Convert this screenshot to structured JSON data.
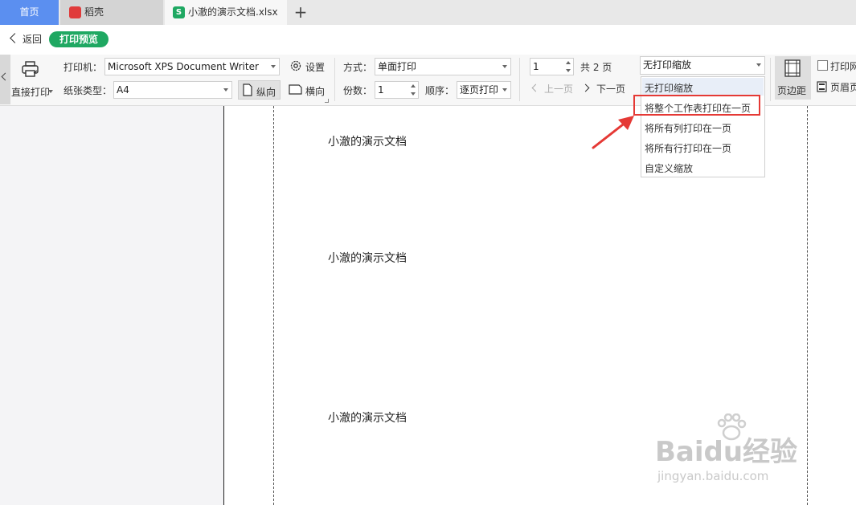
{
  "tabs": {
    "home": "首页",
    "daoke": "稻壳",
    "doc": "小澈的演示文档.xlsx",
    "doc_icon": "S",
    "plus": "+"
  },
  "subbar": {
    "back": "返回",
    "mode": "打印预览"
  },
  "toolbar": {
    "direct_print": "直接打印",
    "printer_label": "打印机：",
    "printer_value": "Microsoft XPS Document Writer",
    "settings": "设置",
    "paper_label": "纸张类型：",
    "paper_value": "A4",
    "portrait": "纵向",
    "landscape": "横向",
    "method_label": "方式：",
    "method_value": "单面打印",
    "copies_label": "份数：",
    "copies_value": "1",
    "order_label": "顺序：",
    "order_value": "逐页打印",
    "page_value": "1",
    "page_total": "共 2 页",
    "prev": "上一页",
    "next": "下一页",
    "scale_value": "无打印缩放",
    "margins": "页边距",
    "print_grid": "打印网",
    "header_footer": "页眉页"
  },
  "dropdown": {
    "items": [
      "无打印缩放",
      "将整个工作表打印在一页",
      "将所有列打印在一页",
      "将所有行打印在一页",
      "自定义缩放"
    ]
  },
  "document": {
    "lines": [
      "小澈的演示文档",
      "小澈的演示文档",
      "小澈的演示文档"
    ]
  },
  "watermark": {
    "brand": "Baidu经验",
    "url": "jingyan.baidu.com"
  },
  "colors": {
    "accent_green": "#1fa862",
    "home_tab_blue": "#5b8ff0",
    "highlight_red": "#e53935"
  }
}
